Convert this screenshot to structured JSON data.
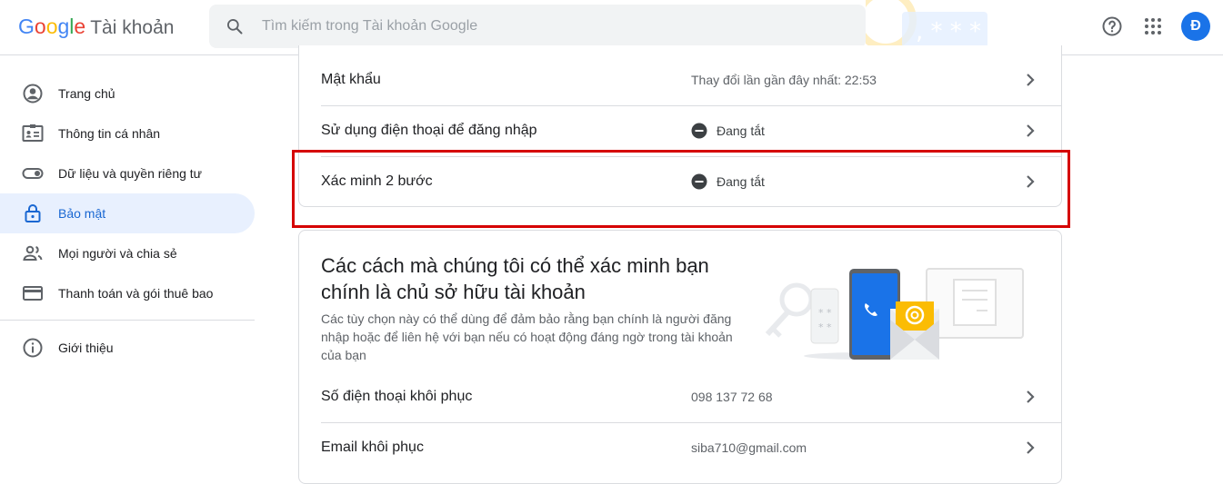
{
  "header": {
    "logo_letters": [
      {
        "char": "G",
        "color": "#4285F4"
      },
      {
        "char": "o",
        "color": "#EA4335"
      },
      {
        "char": "o",
        "color": "#FBBC05"
      },
      {
        "char": "g",
        "color": "#4285F4"
      },
      {
        "char": "l",
        "color": "#34A853"
      },
      {
        "char": "e",
        "color": "#EA4335"
      }
    ],
    "product_name": "Tài khoản",
    "search_placeholder": "Tìm kiếm trong Tài khoản Google",
    "avatar_letter": "Đ",
    "icons": [
      "search-icon",
      "help-icon",
      "apps-grid-icon"
    ]
  },
  "sidebar": {
    "items": [
      {
        "label": "Trang chủ",
        "icon": "account-circle-icon",
        "active": false
      },
      {
        "label": "Thông tin cá nhân",
        "icon": "id-card-icon",
        "active": false
      },
      {
        "label": "Dữ liệu và quyền riêng tư",
        "icon": "toggle-icon",
        "active": false
      },
      {
        "label": "Bảo mật",
        "icon": "lock-icon",
        "active": true
      },
      {
        "label": "Mọi người và chia sẻ",
        "icon": "people-icon",
        "active": false
      },
      {
        "label": "Thanh toán và gói thuê bao",
        "icon": "credit-card-icon",
        "active": false
      },
      {
        "label": "Giới thiệu",
        "icon": "info-icon",
        "active": false
      }
    ]
  },
  "signin_card": {
    "rows": [
      {
        "label": "Mật khẩu",
        "value": "Thay đổi lần gần đây nhất: 22:53",
        "status": false
      },
      {
        "label": "Sử dụng điện thoại để đăng nhập",
        "value": "Đang tắt",
        "status": true
      },
      {
        "label": "Xác minh 2 bước",
        "value": "Đang tắt",
        "status": true
      }
    ]
  },
  "verify_card": {
    "title": "Các cách mà chúng tôi có thể xác minh bạn chính là chủ sở hữu tài khoản",
    "description": "Các tùy chọn này có thể dùng để đảm bảo rằng bạn chính là người đăng nhập hoặc để liên hệ với bạn nếu có hoạt động đáng ngờ trong tài khoản của bạn",
    "rows": [
      {
        "label": "Số điện thoại khôi phục",
        "value": "098 137 72 68"
      },
      {
        "label": "Email khôi phục",
        "value": "siba710@gmail.com"
      }
    ]
  },
  "colors": {
    "accent": "#1a73e8",
    "active_bg": "#e8f0fe",
    "highlight_border": "#d50000"
  }
}
